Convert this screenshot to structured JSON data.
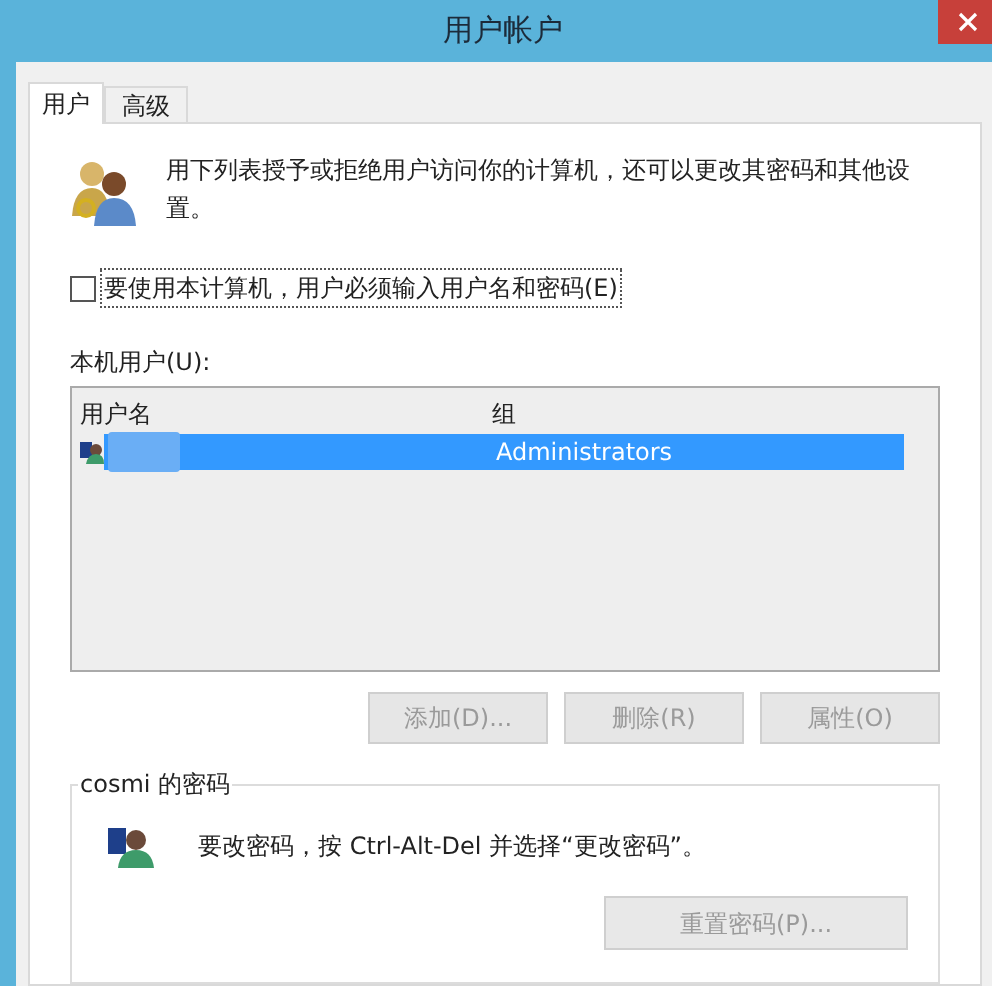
{
  "window": {
    "title": "用户帐户"
  },
  "tabs": [
    {
      "label": "用户",
      "selected": true
    },
    {
      "label": "高级",
      "selected": false
    }
  ],
  "description": "用下列表授予或拒绝用户访问你的计算机，还可以更改其密码和其他设置。",
  "require_password": {
    "label": "要使用本计算机，用户必须输入用户名和密码(E)",
    "checked": false
  },
  "users_label": "本机用户(U):",
  "table": {
    "columns": [
      "用户名",
      "组"
    ],
    "rows": [
      {
        "group": "Administrators",
        "selected": true
      }
    ]
  },
  "buttons": [
    {
      "label": "添加(D)...",
      "disabled": true
    },
    {
      "label": "删除(R)",
      "disabled": true
    },
    {
      "label": "属性(O)",
      "disabled": true
    }
  ],
  "password_group": {
    "title": "cosmi 的密码",
    "message": "要改密码，按 Ctrl-Alt-Del 并选择“更改密码”。",
    "button": {
      "label": "重置密码(P)...",
      "disabled": true
    }
  }
}
